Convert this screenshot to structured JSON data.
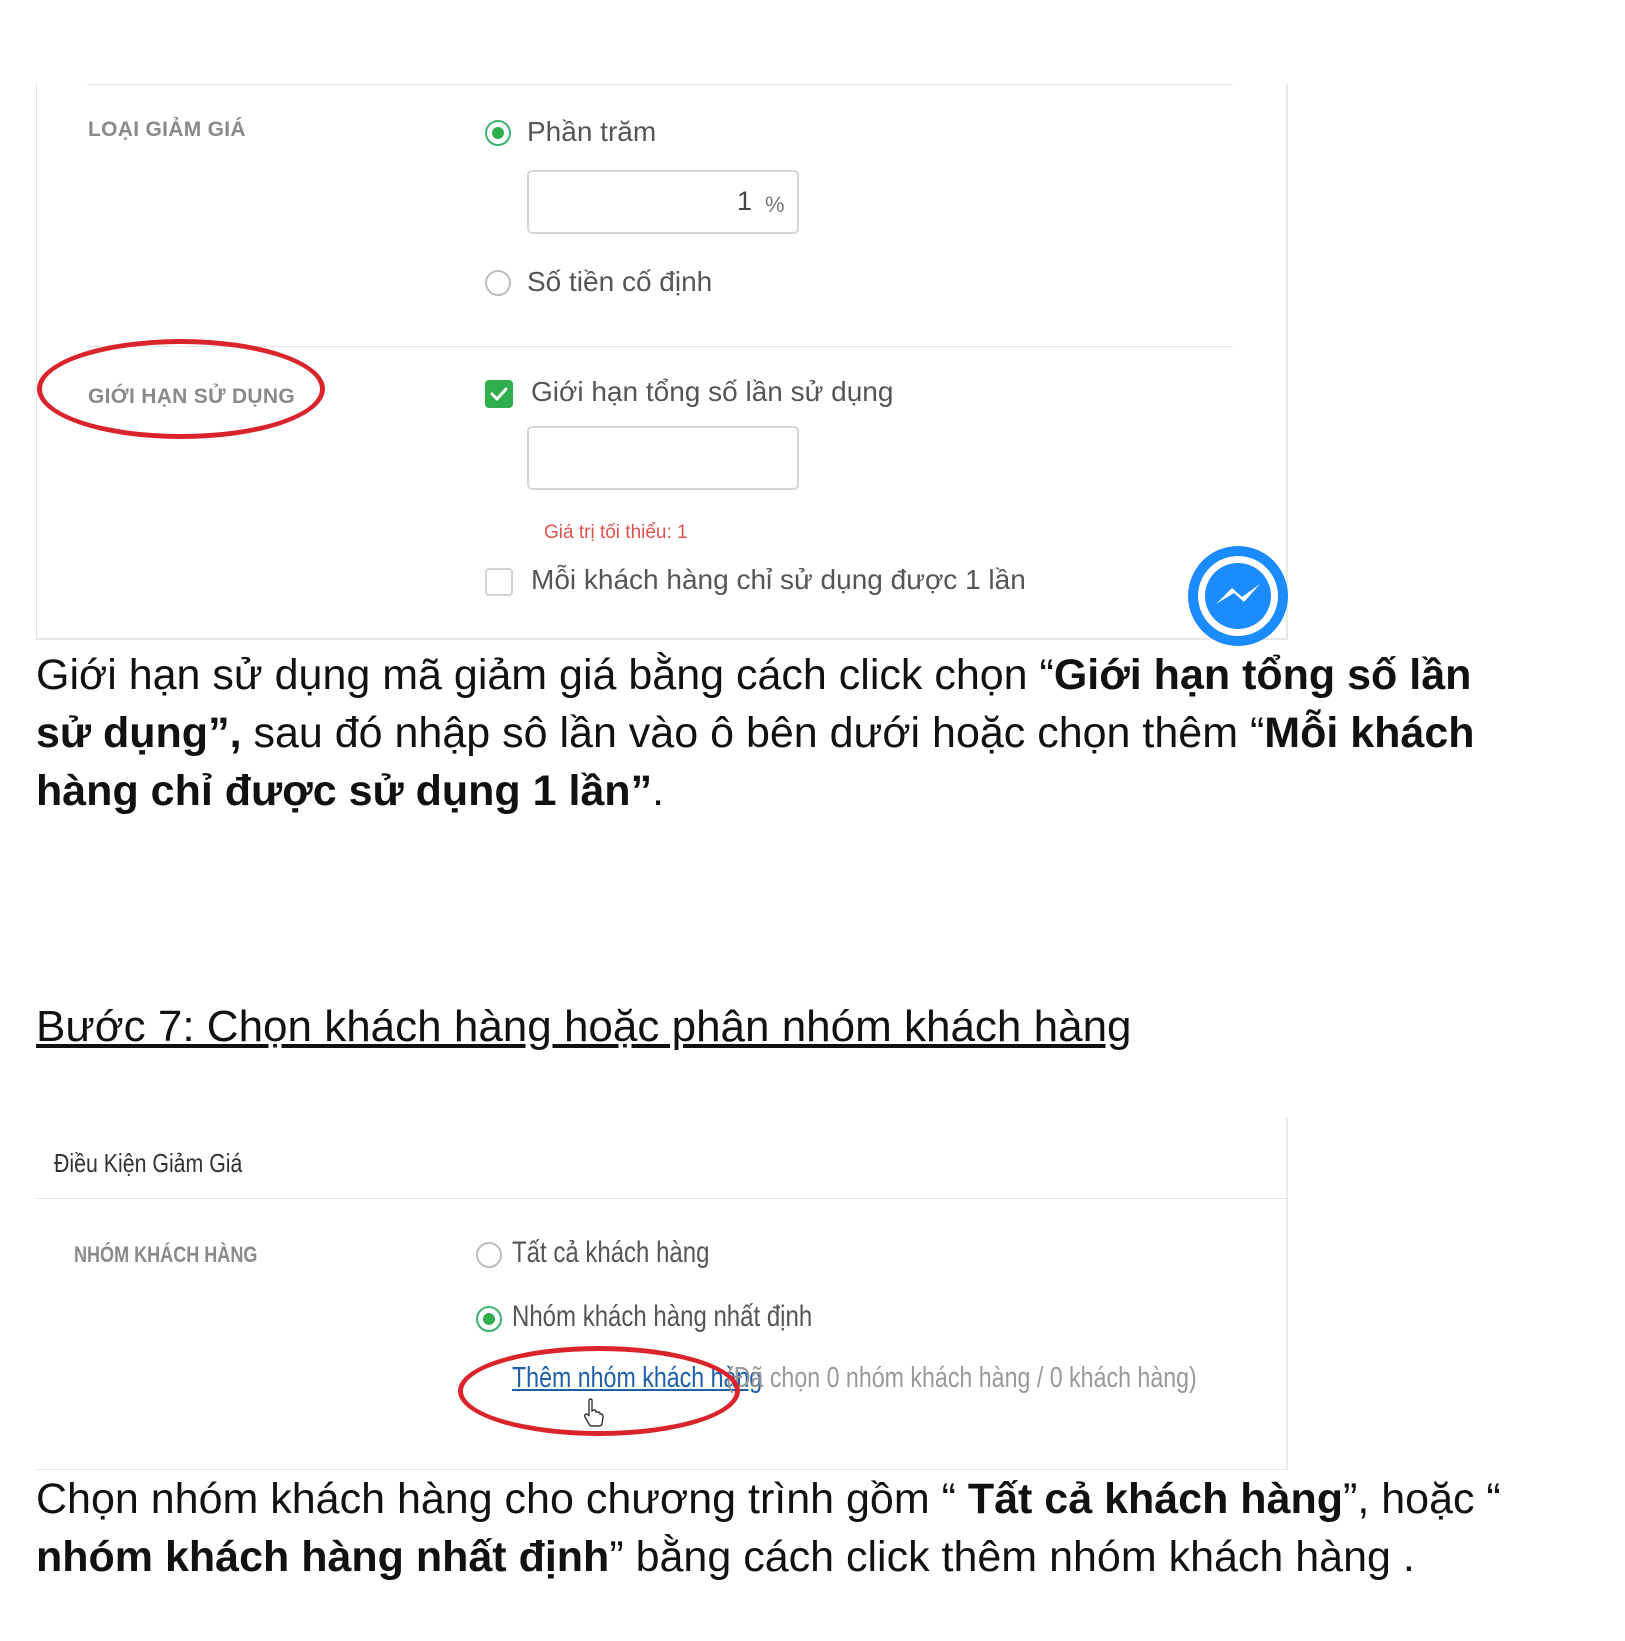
{
  "panel1": {
    "discount_type_label": "LOẠI GIẢM GIÁ",
    "option_percent": "Phần trăm",
    "percent_value": "1",
    "percent_unit": "%",
    "option_fixed": "Số tiền cố định",
    "usage_limit_label": "GIỚI HẠN SỬ DỤNG",
    "limit_total_label": "Giới hạn tổng số lần sử dụng",
    "limit_total_value": "",
    "min_hint": "Giá trị tối thiểu: 1",
    "once_per_customer_label": "Mỗi khách hàng chỉ sử dụng được 1 lần"
  },
  "paragraph1": {
    "p1": "Giới hạn sử dụng mã giảm giá bằng cách click chọn “",
    "b1": "Giới hạn tổng số lần",
    "b2": "sử dụng”,",
    "p2": " sau đó nhập sô lần vào ô bên dưới  hoặc chọn thêm “",
    "b3": "Mỗi khách",
    "b4": "hàng chỉ được sử dụng 1 lần”",
    "p3": "."
  },
  "step7": {
    "title": "Bước 7: Chọn khách hàng hoặc phân nhóm khách hàng"
  },
  "panel2": {
    "title": "Điều Kiện Giảm Giá",
    "group_label": "NHÓM KHÁCH HÀNG",
    "option_all": "Tất cả khách hàng",
    "option_specific": "Nhóm khách hàng nhất định",
    "add_group_link": "Thêm nhóm khách hàng",
    "selected_note": "(Đã chọn 0 nhóm khách hàng / 0 khách hàng)"
  },
  "paragraph2": {
    "p1": "Chọn nhóm khách hàng cho chương trình gồm “ ",
    "b1": "Tất cả khách hàng",
    "p2": "”, hoặc “",
    "b2": "nhóm khách hàng nhất định",
    "p3": "” bằng cách click thêm nhóm khách hàng ."
  },
  "colors": {
    "accent_green": "#2fae4e",
    "annotation_red": "#d9242b",
    "messenger_blue": "#1a8cff",
    "link_blue": "#1f5fa8"
  },
  "icons": [
    "messenger-icon",
    "check-icon",
    "hand-cursor-icon"
  ]
}
